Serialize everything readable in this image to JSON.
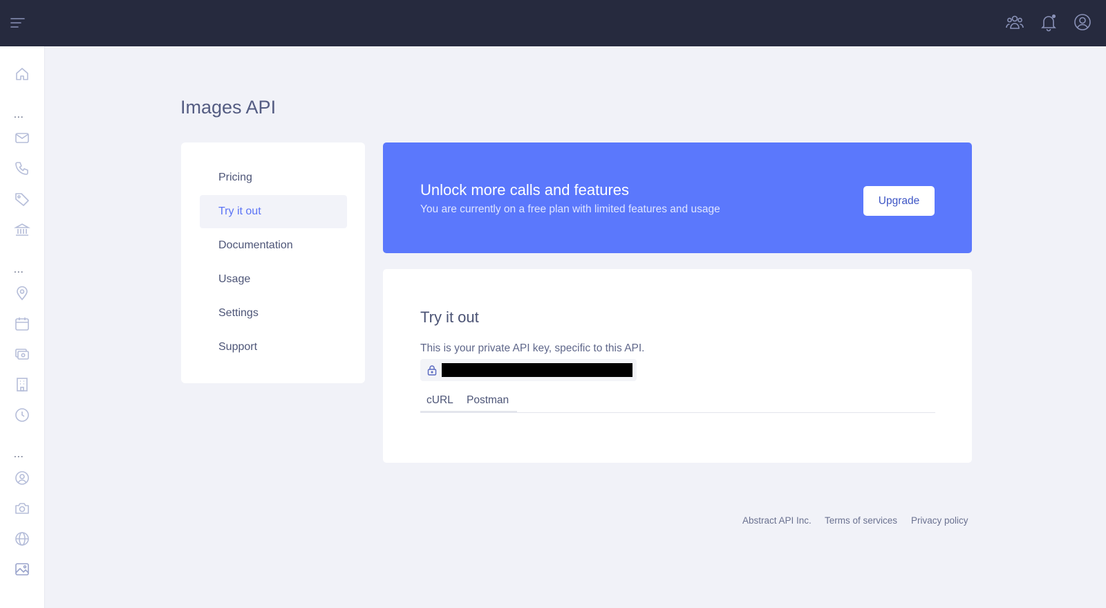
{
  "header": {
    "menu_icon": "hamburger-menu-icon",
    "icons": [
      "team-icon",
      "bell-icon",
      "user-circle-icon"
    ]
  },
  "sidebar": {
    "dots": "...",
    "icons": [
      "home-icon",
      "mail-icon",
      "phone-icon",
      "tag-icon",
      "bank-icon",
      "location-pin-icon",
      "calendar-icon",
      "currency-icon",
      "building-icon",
      "clock-icon",
      "user-circle-icon",
      "camera-icon",
      "globe-icon",
      "image-icon"
    ]
  },
  "page": {
    "title": "Images API"
  },
  "subnav": {
    "items": [
      {
        "label": "Pricing",
        "active": false
      },
      {
        "label": "Try it out",
        "active": true
      },
      {
        "label": "Documentation",
        "active": false
      },
      {
        "label": "Usage",
        "active": false
      },
      {
        "label": "Settings",
        "active": false
      },
      {
        "label": "Support",
        "active": false
      }
    ]
  },
  "banner": {
    "title": "Unlock more calls and features",
    "subtitle": "You are currently on a free plan with limited features and usage",
    "button_label": "Upgrade"
  },
  "try_it_out": {
    "title": "Try it out",
    "description": "This is your private API key, specific to this API.",
    "lock_icon": "lock-icon",
    "tabs": [
      "cURL",
      "Postman"
    ]
  },
  "footer": {
    "company": "Abstract API Inc.",
    "terms": "Terms of services",
    "privacy": "Privacy policy"
  },
  "colors": {
    "topbar": "#262a3e",
    "accent": "#5b78fc",
    "background": "#f1f2f8"
  }
}
